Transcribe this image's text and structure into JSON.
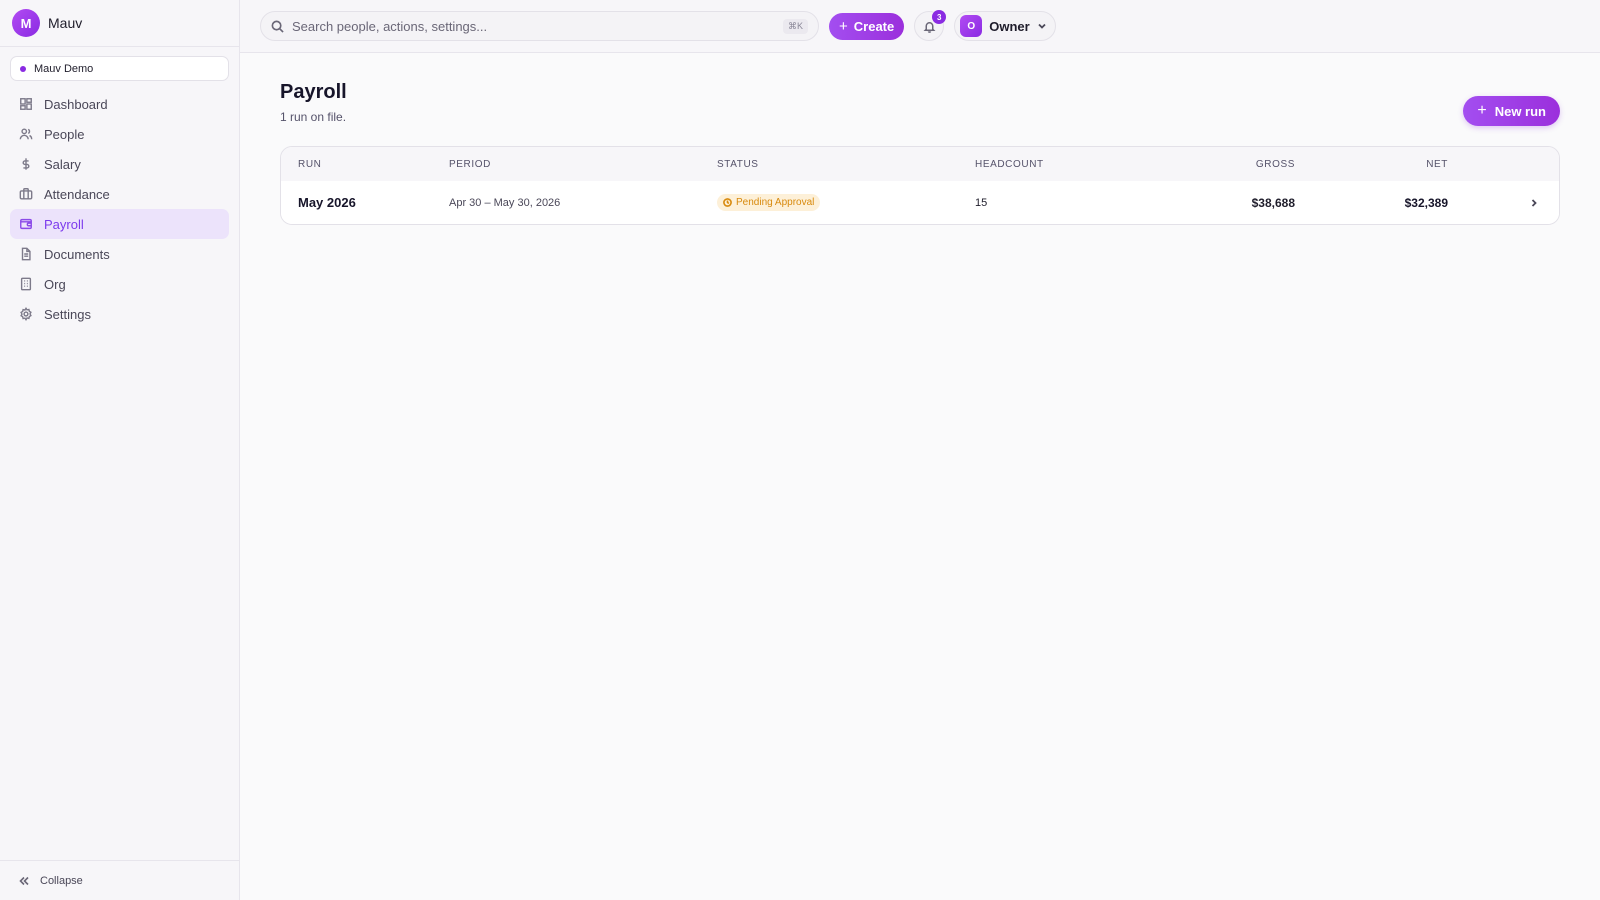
{
  "brand": {
    "logo_letter": "M",
    "name": "Mauv"
  },
  "workspace": {
    "name": "Mauv Demo"
  },
  "nav": {
    "items": [
      {
        "label": "Dashboard",
        "icon": "dashboard-icon"
      },
      {
        "label": "People",
        "icon": "people-icon"
      },
      {
        "label": "Salary",
        "icon": "dollar-icon"
      },
      {
        "label": "Attendance",
        "icon": "briefcase-icon"
      },
      {
        "label": "Payroll",
        "icon": "wallet-icon",
        "active": true
      },
      {
        "label": "Documents",
        "icon": "document-icon"
      },
      {
        "label": "Org",
        "icon": "building-icon"
      },
      {
        "label": "Settings",
        "icon": "gear-icon"
      }
    ],
    "collapse_label": "Collapse"
  },
  "topbar": {
    "search_placeholder": "Search people, actions, settings...",
    "search_shortcut": "⌘K",
    "create_label": "Create",
    "notification_count": "3",
    "user_initial": "O",
    "user_name": "Owner"
  },
  "page": {
    "title": "Payroll",
    "subtitle": "1 run on file.",
    "new_run_label": "New run"
  },
  "table": {
    "headers": {
      "run": "RUN",
      "period": "PERIOD",
      "status": "STATUS",
      "headcount": "HEADCOUNT",
      "gross": "GROSS",
      "net": "NET"
    },
    "rows": [
      {
        "run": "May 2026",
        "period": "Apr 30 – May 30, 2026",
        "status": "Pending Approval",
        "headcount": "15",
        "gross": "$38,688",
        "net": "$32,389"
      }
    ]
  },
  "colors": {
    "accent": "#8a2be2",
    "active_bg": "#ece3fb",
    "pending_bg": "#fdf0d8",
    "pending_text": "#d88a0e"
  }
}
